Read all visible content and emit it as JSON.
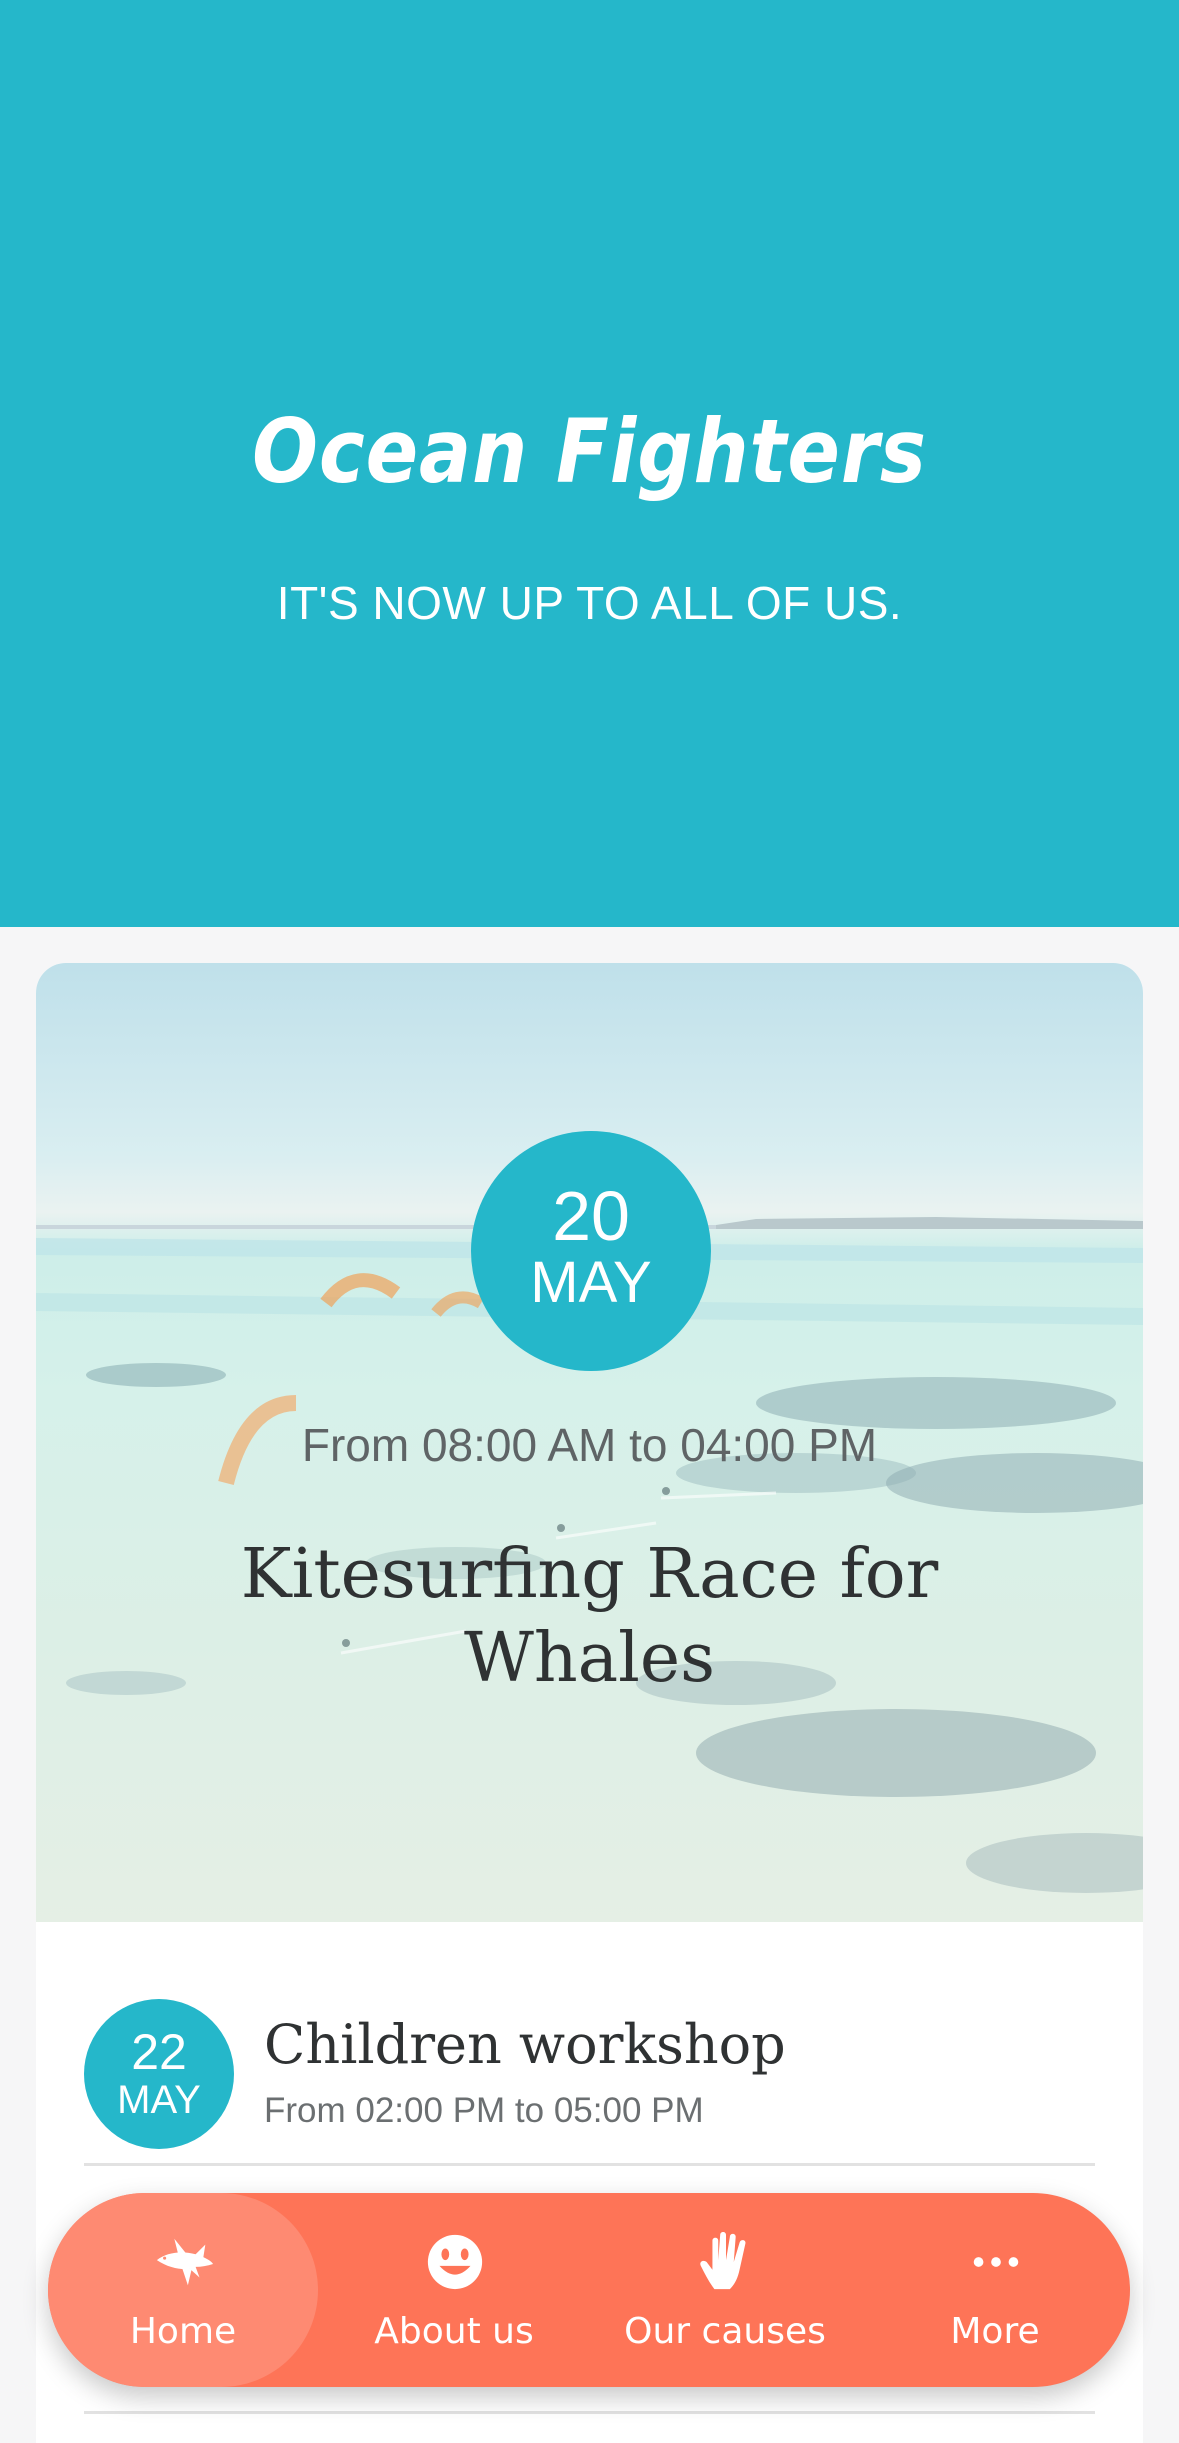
{
  "hero": {
    "title": "Ocean Fighters",
    "subtitle": "IT'S NOW UP TO ALL OF US."
  },
  "featured_event": {
    "day": "20",
    "month": "MAY",
    "time": "From 08:00 AM to 04:00 PM",
    "title": "Kitesurfing Race for Whales"
  },
  "events": [
    {
      "day": "22",
      "month": "MAY",
      "title": "Children workshop",
      "time": "From 02:00 PM to 05:00 PM"
    }
  ],
  "tabbar": {
    "home": "Home",
    "about": "About us",
    "causes": "Our causes",
    "more": "More"
  },
  "colors": {
    "primary": "#25b7ca",
    "accent": "#fe7457",
    "accent_active": "#fe8a72",
    "background": "#f6f6f7"
  },
  "icons": {
    "home": "shark-icon",
    "about": "smiley-icon",
    "causes": "hand-icon",
    "more": "dots-icon"
  }
}
